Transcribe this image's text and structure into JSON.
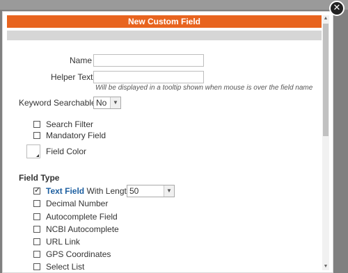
{
  "dialog": {
    "title": "New Custom Field",
    "close_symbol": "✕"
  },
  "form": {
    "name_label": "Name",
    "name_value": "",
    "helper_label": "Helper Text",
    "helper_value": "",
    "helper_hint": "Will be displayed in a tooltip shown when mouse is over the field name",
    "keyword_label": "Keyword Searchable",
    "keyword_value": "No",
    "search_filter_label": "Search Filter",
    "mandatory_label": "Mandatory Field",
    "field_color_label": "Field Color"
  },
  "field_type": {
    "title": "Field Type",
    "text_field_label": "Text Field",
    "with_length_label": "With Length",
    "length_value": "50",
    "options": [
      "Decimal Number",
      "Autocomplete Field",
      "NCBI Autocomplete",
      "URL Link",
      "GPS Coordinates",
      "Select List"
    ]
  },
  "colors": {
    "header": "#e8641f",
    "link": "#1d5fa0"
  }
}
